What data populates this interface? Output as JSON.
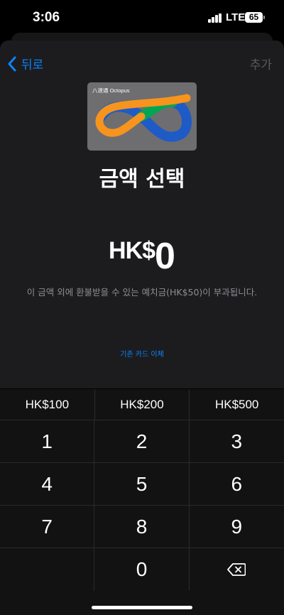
{
  "status": {
    "time": "3:06",
    "network": "LTE",
    "battery": "65"
  },
  "nav": {
    "back_label": "뒤로",
    "add_label": "추가"
  },
  "card": {
    "label": "八達通 Octopus",
    "colors": {
      "orange": "#f7941d",
      "green": "#00a651",
      "blue": "#1e5bc6",
      "base": "#6e6e70"
    }
  },
  "title": "금액 선택",
  "amount": {
    "currency": "HK$",
    "value": "0"
  },
  "note": "이 금액 외에 환불받을 수 있는 예치금(HK$50)이 부과됩니다.",
  "switch_link": "기존 카드 이체",
  "presets": [
    "HK$100",
    "HK$200",
    "HK$500"
  ],
  "keys": [
    "1",
    "2",
    "3",
    "4",
    "5",
    "6",
    "7",
    "8",
    "9",
    "",
    "0",
    "delete-icon"
  ],
  "accent": "#0a84ff"
}
